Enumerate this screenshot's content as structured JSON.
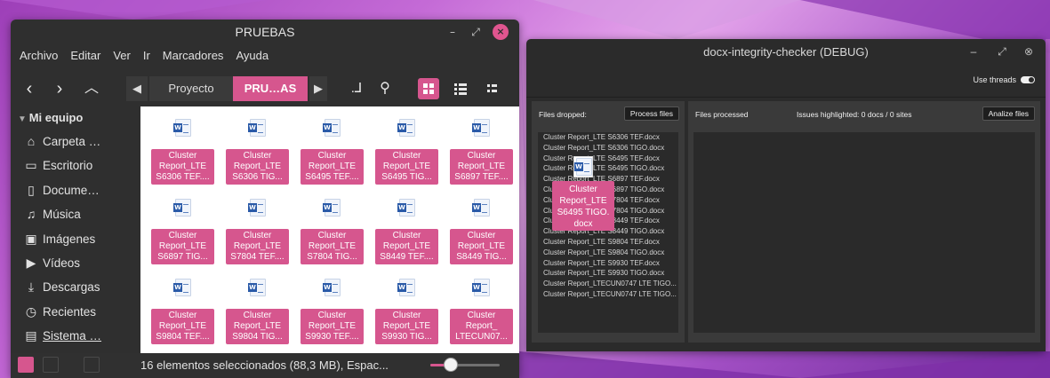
{
  "file_manager": {
    "title": "PRUEBAS",
    "menu": [
      "Archivo",
      "Editar",
      "Ver",
      "Ir",
      "Marcadores",
      "Ayuda"
    ],
    "breadcrumbs": [
      {
        "label": "Proyecto",
        "active": false
      },
      {
        "label": "PRU…AS",
        "active": true
      }
    ],
    "sidebar": {
      "header": "Mi equipo",
      "items": [
        {
          "label": "Carpeta …",
          "icon": "home-icon"
        },
        {
          "label": "Escritorio",
          "icon": "folder-icon"
        },
        {
          "label": "Docume…",
          "icon": "document-icon"
        },
        {
          "label": "Música",
          "icon": "music-icon"
        },
        {
          "label": "Imágenes",
          "icon": "image-icon"
        },
        {
          "label": "Vídeos",
          "icon": "video-icon"
        },
        {
          "label": "Descargas",
          "icon": "download-icon"
        },
        {
          "label": "Recientes",
          "icon": "history-icon"
        },
        {
          "label": "Sistema …",
          "icon": "drive-icon"
        }
      ]
    },
    "files": [
      "Cluster\nReport_LTE\nS6306 TEF....",
      "Cluster\nReport_LTE\nS6306 TIG...",
      "Cluster\nReport_LTE\nS6495 TEF....",
      "Cluster\nReport_LTE\nS6495 TIG...",
      "Cluster\nReport_LTE\nS6897 TEF....",
      "Cluster\nReport_LTE\nS6897 TIG...",
      "Cluster\nReport_LTE\nS7804 TEF....",
      "Cluster\nReport_LTE\nS7804 TIG...",
      "Cluster\nReport_LTE\nS8449 TEF....",
      "Cluster\nReport_LTE\nS8449 TIG...",
      "Cluster\nReport_LTE\nS9804 TEF....",
      "Cluster\nReport_LTE\nS9804 TIG...",
      "Cluster\nReport_LTE\nS9930 TEF....",
      "Cluster\nReport_LTE\nS9930 TIG...",
      "Cluster\nReport_\nLTECUN07..."
    ],
    "status": "16 elementos seleccionados (88,3 MB), Espac...",
    "zoom_level": 0.3,
    "accent": "#d6568e"
  },
  "debug_window": {
    "title": "docx-integrity-checker (DEBUG)",
    "use_threads_label": "Use threads",
    "use_threads_on": true,
    "dropped_label": "Files dropped:",
    "process_button": "Process files",
    "processed_label": "Files processed",
    "issues_label": "Issues highlighted: 0 docs / 0 sites",
    "analize_button": "Analize files",
    "dropped_files": [
      "Cluster Report_LTE S6306 TEF.docx",
      "Cluster Report_LTE S6306 TIGO.docx",
      "Cluster Report_LTE S6495 TEF.docx",
      "Cluster Report_LTE S6495 TIGO.docx",
      "Cluster Report_LTE S6897 TEF.docx",
      "Cluster Report_LTE S6897 TIGO.docx",
      "Cluster Report_LTE S7804 TEF.docx",
      "Cluster Report_LTE S7804 TIGO.docx",
      "Cluster Report_LTE S8449 TEF.docx",
      "Cluster Report_LTE S8449 TIGO.docx",
      "Cluster Report_LTE S9804 TEF.docx",
      "Cluster Report_LTE S9804 TIGO.docx",
      "Cluster Report_LTE S9930 TEF.docx",
      "Cluster Report_LTE S9930 TIGO.docx",
      "Cluster Report_LTECUN0747 LTE TIGO...",
      "Cluster Report_LTECUN0747 LTE TIGO..."
    ]
  },
  "drag_ghost": {
    "label": "Cluster\nReport_LTE\nS6495 TIGO.\ndocx"
  }
}
